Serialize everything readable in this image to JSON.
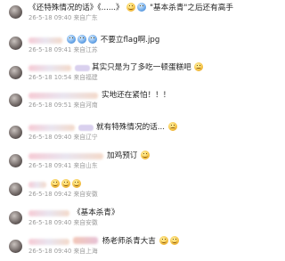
{
  "comments": [
    {
      "text_before": "《还特殊情况的话》《......》",
      "text_after": "\"基本杀青\"之后还有高手",
      "time": "26-5-18 09:40",
      "location": "来自广东",
      "emojis_before": [
        "smile-emoji",
        "smile-emoji"
      ],
      "emojis_after": [
        "blue-emoji"
      ]
    },
    {
      "text": "不要立flag啊.jpg",
      "time": "26-5-18 09:41",
      "location": "来自江苏",
      "emojis_before": [
        "blue-emoji",
        "blue-emoji",
        "blue-emoji"
      ]
    },
    {
      "text": "其实只是为了多吃一顿蛋糕吧",
      "time": "26-5-18 10:54",
      "location": "来自福建",
      "emojis_after": [
        "sad-emoji"
      ]
    },
    {
      "text": "实地还在紧怕！！！",
      "time": "26-5-18 09:51",
      "location": "来自河南"
    },
    {
      "text": "就有特殊情况的话...",
      "time": "26-5-18 09:40",
      "location": "来自辽宁",
      "emojis_after": [
        "sad-emoji"
      ]
    },
    {
      "text": "加鸡预订",
      "time": "26-5-18 09:41",
      "location": "来自山东",
      "emojis_after": [
        "smile-emoji"
      ]
    },
    {
      "text": "",
      "time": "26-5-18 09:42",
      "location": "来自安徽",
      "emojis_after": [
        "smile-emoji",
        "smile-emoji",
        "smile-emoji"
      ]
    },
    {
      "text": "《基本杀青》",
      "time": "26-5-18 09:40",
      "location": "来自安徽"
    },
    {
      "text": "杨老师杀青大吉",
      "time": "26-5-18 09:40",
      "location": "来自上海",
      "emojis_after": [
        "smile-emoji",
        "smile-emoji"
      ]
    }
  ]
}
